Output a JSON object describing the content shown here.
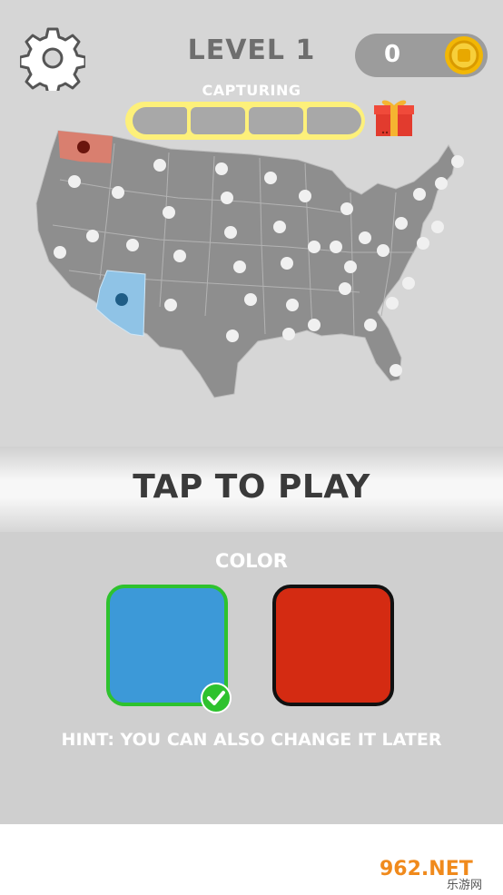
{
  "header": {
    "level_label": "LEVEL 1",
    "coins": "0",
    "capturing_label": "CAPTURING"
  },
  "progress": {
    "segments_total": 4,
    "segments_filled": 0
  },
  "map": {
    "state_marker_value": "10",
    "captured_states": [
      {
        "name": "washington",
        "color": "#d97f6f"
      },
      {
        "name": "arizona",
        "color": "#8fc3e6"
      }
    ]
  },
  "play": {
    "label": "TAP TO PLAY"
  },
  "color_picker": {
    "label": "COLOR",
    "options": [
      {
        "name": "blue",
        "color": "#3c99d8",
        "selected": true
      },
      {
        "name": "red",
        "color": "#d42b12",
        "selected": false
      }
    ],
    "hint": "HINT: YOU CAN ALSO CHANGE IT LATER"
  },
  "watermark": {
    "text1": "962.NET",
    "text2": "乐游网"
  }
}
